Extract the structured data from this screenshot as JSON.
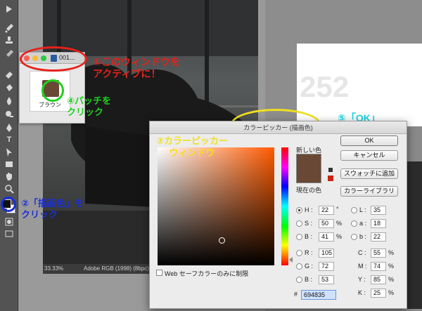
{
  "status": {
    "zoom": "33.33%",
    "profile": "Adobe RGB (1998) (8bpc)"
  },
  "tools": [
    "brush-icon",
    "stamp-icon",
    "history-brush-icon",
    "eraser-icon",
    "bucket-icon",
    "blur-icon",
    "dodge-icon",
    "pen-icon",
    "type-icon",
    "path-select-icon",
    "shape-icon",
    "hand-icon",
    "zoom-icon"
  ],
  "right_overlay": {
    "big_text": "252"
  },
  "palette": {
    "tab_text": "001...",
    "patch_label": "ブラウン",
    "patch_color": "#694835"
  },
  "annotations": {
    "step1": "①このウィンドウを\nアクティブに！",
    "step2": "②「描画色」を\nクリック",
    "step3": "③カラーピッカー\nウィンドウ",
    "step4": "④パッチを\nクリック",
    "step5": "⑤「OK」"
  },
  "dialog": {
    "title": "カラーピッカー (描画色)",
    "new_label": "新しい色",
    "current_label": "現在の色",
    "ok": "OK",
    "cancel": "キャンセル",
    "add_swatch": "スウォッチに追加",
    "libraries": "カラーライブラリ",
    "web_only": "Web セーフカラーのみに制限",
    "hsb": [
      {
        "label": "H :",
        "value": "22",
        "unit": "°"
      },
      {
        "label": "S :",
        "value": "50",
        "unit": "%"
      },
      {
        "label": "B :",
        "value": "41",
        "unit": "%"
      }
    ],
    "rgb": [
      {
        "label": "R :",
        "value": "105"
      },
      {
        "label": "G :",
        "value": "72"
      },
      {
        "label": "B :",
        "value": "53"
      }
    ],
    "lab": [
      {
        "label": "L :",
        "value": "35"
      },
      {
        "label": "a :",
        "value": "18"
      },
      {
        "label": "b :",
        "value": "22"
      }
    ],
    "cmyk": [
      {
        "label": "C :",
        "value": "55",
        "unit": "%"
      },
      {
        "label": "M :",
        "value": "74",
        "unit": "%"
      },
      {
        "label": "Y :",
        "value": "85",
        "unit": "%"
      },
      {
        "label": "K :",
        "value": "25",
        "unit": "%"
      }
    ],
    "hex_label": "#",
    "hex": "694835"
  },
  "colors": {
    "red": "#e8201a",
    "green": "#1fd11f",
    "blue": "#1a2ed8",
    "yellow": "#f0e020",
    "cyan": "#18d6e0",
    "selected": "#694835"
  }
}
